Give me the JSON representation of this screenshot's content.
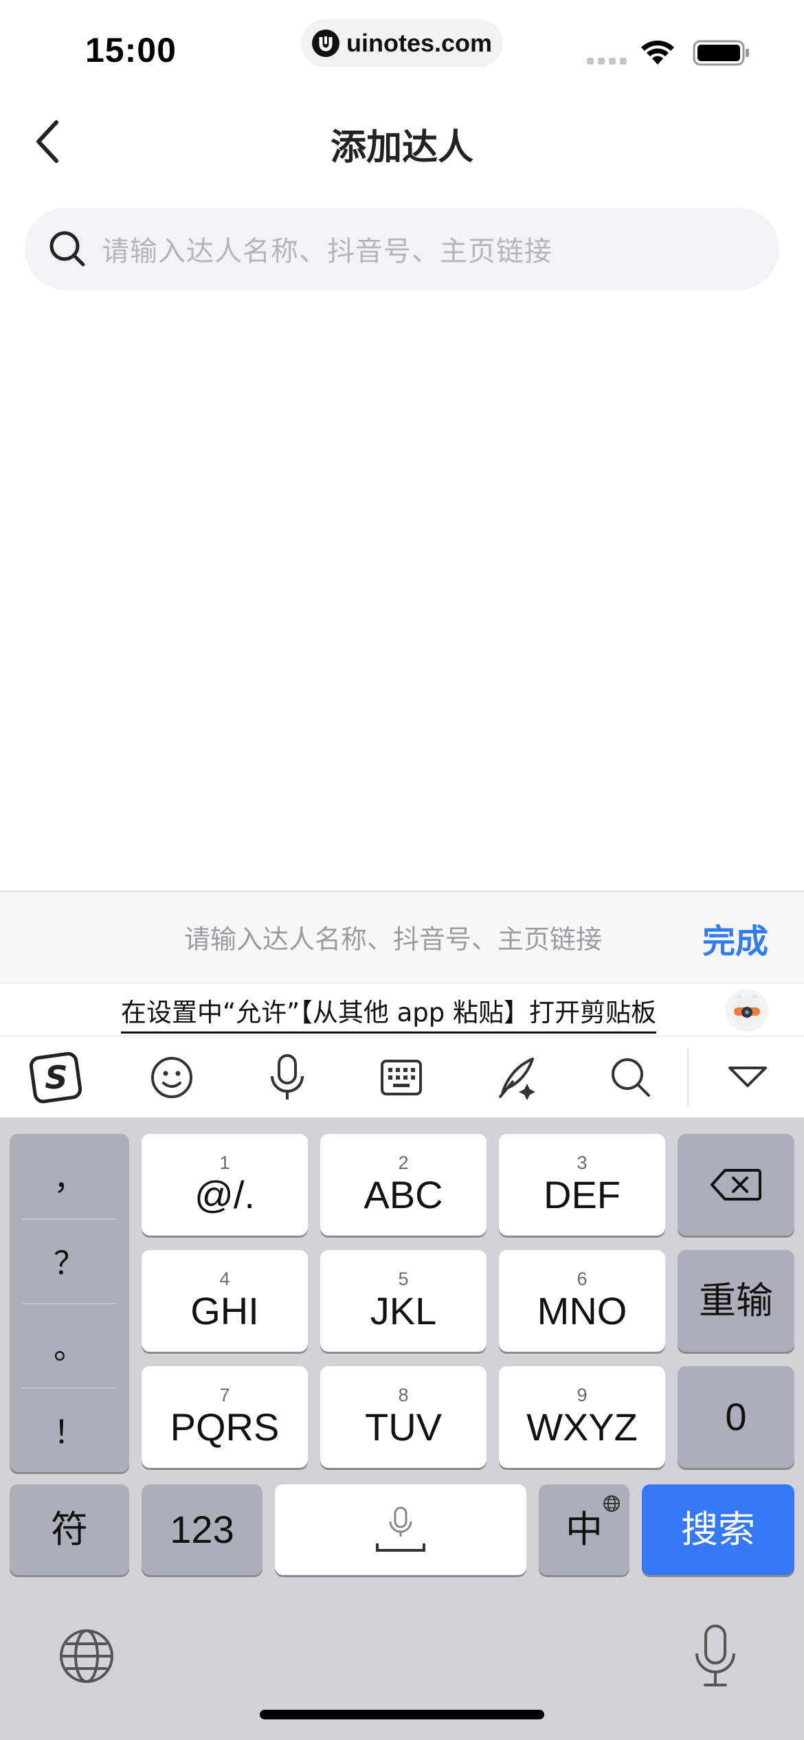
{
  "status_bar": {
    "time": "15:00",
    "url": "uinotes.com"
  },
  "nav": {
    "title": "添加达人"
  },
  "search": {
    "placeholder": "请输入达人名称、抖音号、主页链接"
  },
  "accessory": {
    "hint": "请输入达人名称、抖音号、主页链接",
    "done_label": "完成"
  },
  "clipboard_tip": "在设置中“允许”【从其他 app 粘贴】打开剪贴板",
  "toolbar": {
    "icons": [
      "sogou-logo-icon",
      "emoji-icon",
      "voice-icon",
      "keyboard-icon",
      "handwriting-icon",
      "search-icon",
      "collapse-icon"
    ]
  },
  "keyboard": {
    "punctuation": [
      "，",
      "？",
      "。",
      "！"
    ],
    "keys": [
      {
        "num": "1",
        "label": "@/."
      },
      {
        "num": "2",
        "label": "ABC"
      },
      {
        "num": "3",
        "label": "DEF"
      },
      {
        "num": "4",
        "label": "GHI"
      },
      {
        "num": "5",
        "label": "JKL"
      },
      {
        "num": "6",
        "label": "MNO"
      },
      {
        "num": "7",
        "label": "PQRS"
      },
      {
        "num": "8",
        "label": "TUV"
      },
      {
        "num": "9",
        "label": "WXYZ"
      }
    ],
    "reset_label": "重输",
    "zero_label": "0",
    "symbol_label": "符",
    "numbers_label": "123",
    "lang_label": "中",
    "search_label": "搜索"
  },
  "colors": {
    "accent": "#2f7cf6",
    "keyboard_bg": "#d2d3d8",
    "search_key": "#3478f6"
  }
}
